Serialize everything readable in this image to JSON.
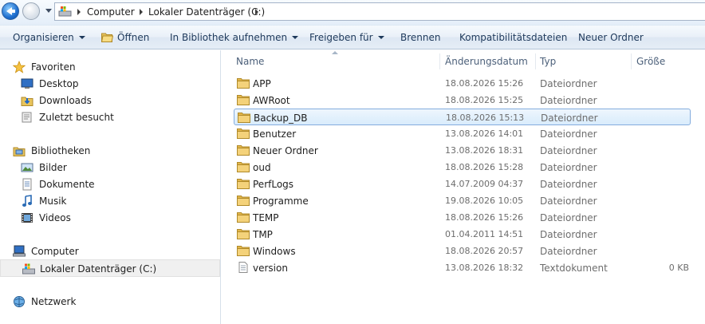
{
  "address": {
    "crumbs": [
      "Computer",
      "Lokaler Datenträger (C:)"
    ]
  },
  "toolbar": {
    "organize": "Organisieren",
    "open": "Öffnen",
    "include_library": "In Bibliothek aufnehmen",
    "share": "Freigeben für",
    "burn": "Brennen",
    "compat_files": "Kompatibilitätsdateien",
    "new_folder": "Neuer Ordner"
  },
  "nav": {
    "favorites": {
      "label": "Favoriten",
      "icon": "star-icon",
      "items": [
        "Desktop",
        "Downloads",
        "Zuletzt besucht"
      ]
    },
    "libraries": {
      "label": "Bibliotheken",
      "icon": "library-icon",
      "items": [
        "Bilder",
        "Dokumente",
        "Musik",
        "Videos"
      ]
    },
    "computer": {
      "label": "Computer",
      "icon": "computer-icon",
      "items": [
        "Lokaler Datenträger (C:)"
      ]
    },
    "network": {
      "label": "Netzwerk",
      "icon": "network-icon"
    }
  },
  "columns": {
    "name": "Name",
    "date": "Änderungsdatum",
    "type": "Typ",
    "size": "Größe"
  },
  "files": [
    {
      "name": "APP",
      "date": "18.08.2026 15:26",
      "type": "Dateiordner",
      "size": "",
      "icon": "folder-icon"
    },
    {
      "name": "AWRoot",
      "date": "18.08.2026 15:25",
      "type": "Dateiordner",
      "size": "",
      "icon": "folder-icon"
    },
    {
      "name": "Backup_DB",
      "date": "18.08.2026 15:13",
      "type": "Dateiordner",
      "size": "",
      "icon": "folder-icon",
      "selected": true
    },
    {
      "name": "Benutzer",
      "date": "13.08.2026 14:01",
      "type": "Dateiordner",
      "size": "",
      "icon": "folder-icon"
    },
    {
      "name": "Neuer Ordner",
      "date": "13.08.2026 18:31",
      "type": "Dateiordner",
      "size": "",
      "icon": "folder-icon"
    },
    {
      "name": "oud",
      "date": "18.08.2026 15:28",
      "type": "Dateiordner",
      "size": "",
      "icon": "folder-icon"
    },
    {
      "name": "PerfLogs",
      "date": "14.07.2009 04:37",
      "type": "Dateiordner",
      "size": "",
      "icon": "folder-icon"
    },
    {
      "name": "Programme",
      "date": "19.08.2026 10:05",
      "type": "Dateiordner",
      "size": "",
      "icon": "folder-icon"
    },
    {
      "name": "TEMP",
      "date": "18.08.2026 15:26",
      "type": "Dateiordner",
      "size": "",
      "icon": "folder-icon"
    },
    {
      "name": "TMP",
      "date": "01.04.2011 14:51",
      "type": "Dateiordner",
      "size": "",
      "icon": "folder-icon"
    },
    {
      "name": "Windows",
      "date": "18.08.2026 20:57",
      "type": "Dateiordner",
      "size": "",
      "icon": "folder-icon"
    },
    {
      "name": "version",
      "date": "13.08.2026 18:32",
      "type": "Textdokument",
      "size": "0 KB",
      "icon": "text-file-icon"
    }
  ],
  "colors": {
    "selection_border": "#84acdd",
    "selection_fill": "#d9ecfc",
    "command_text": "#1e395b"
  }
}
